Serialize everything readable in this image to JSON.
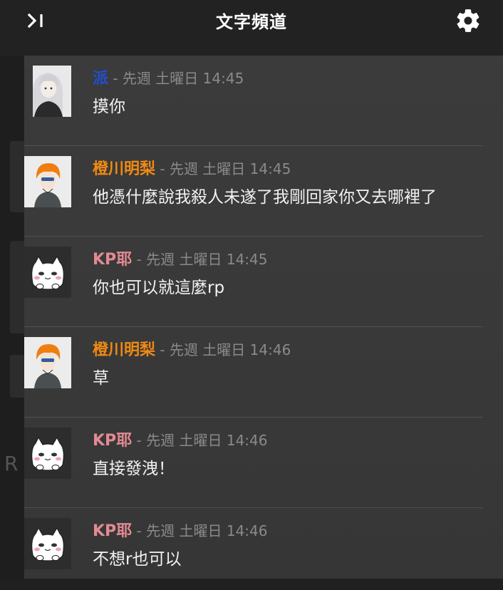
{
  "header": {
    "title": "文字頻道",
    "collapse_icon": "collapse-panel-icon",
    "settings_icon": "gear-icon"
  },
  "colors": {
    "name_blue": "#1f4fd6",
    "name_orange": "#f08a12",
    "name_pink": "#e48a92",
    "timestamp": "#8a8a8a",
    "message_text": "#f2f2f2"
  },
  "messages": [
    {
      "author": "派",
      "sep": " - ",
      "timestamp": "先週 土曜日 14:45",
      "text": "摸你",
      "avatar": "white-haired-character-avatar"
    },
    {
      "author": "橙川明梨",
      "sep": " - ",
      "timestamp": "先週 土曜日 14:45",
      "text": "他憑什麼說我殺人未遂了我剛回家你又去哪裡了",
      "avatar": "orange-haired-character-avatar"
    },
    {
      "author": "KP耶",
      "sep": " - ",
      "timestamp": "先週 土曜日 14:45",
      "text": "你也可以就這麼rp",
      "avatar": "white-cat-avatar"
    },
    {
      "author": "橙川明梨",
      "sep": " - ",
      "timestamp": "先週 土曜日 14:46",
      "text": "草",
      "avatar": "orange-haired-character-avatar"
    },
    {
      "author": "KP耶",
      "sep": " - ",
      "timestamp": "先週 土曜日 14:46",
      "text": "直接發洩！",
      "avatar": "white-cat-avatar"
    },
    {
      "author": "KP耶",
      "sep": " - ",
      "timestamp": "先週 土曜日 14:46",
      "text": "不想r也可以",
      "avatar": "white-cat-avatar"
    }
  ]
}
